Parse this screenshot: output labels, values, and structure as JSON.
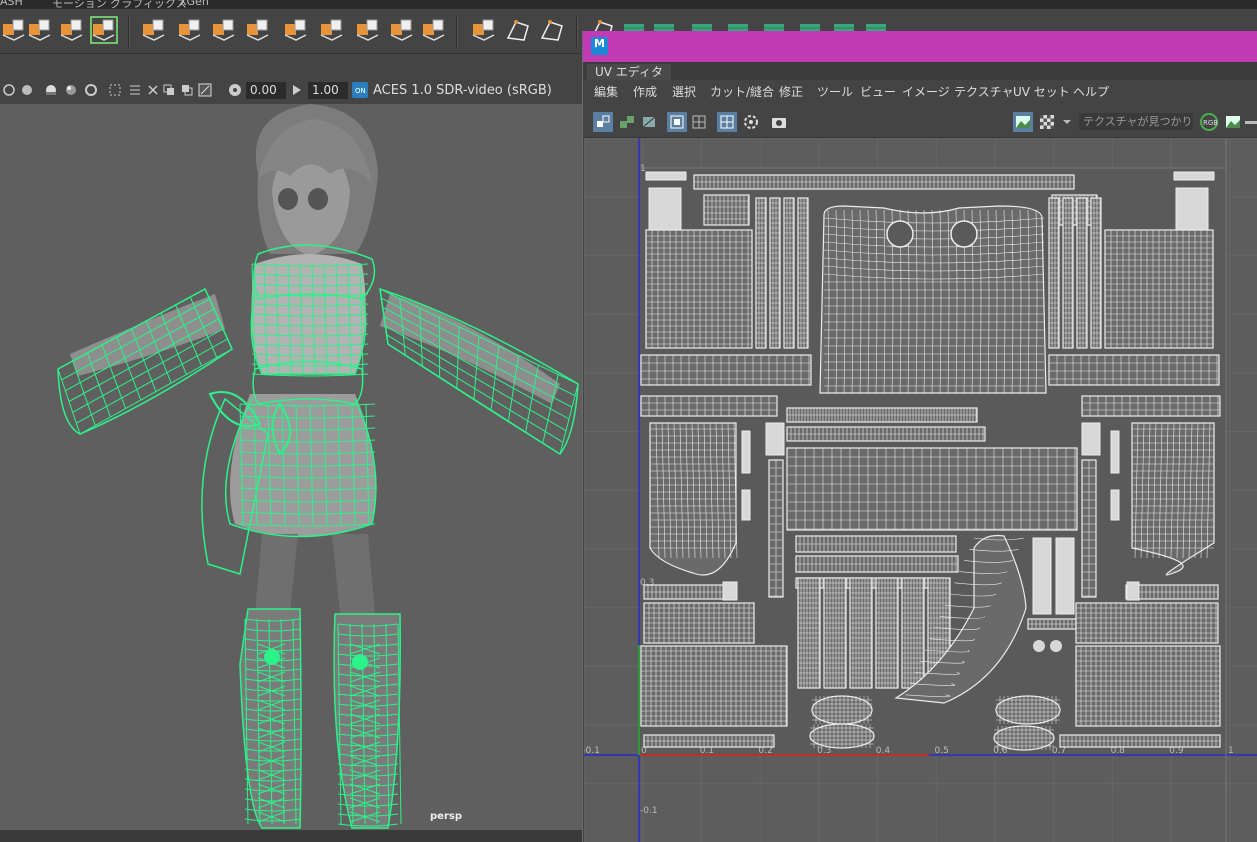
{
  "main_window": {
    "shelf_tabs": [
      "ASH",
      "モーション グラフィックス",
      "XGen"
    ],
    "shelf_icons": [
      "poly-cube-icon",
      "poly-plane-icon",
      "rotate-uv-icon",
      "rotate-uv-selected-icon",
      "extrude-icon",
      "bevel-icon",
      "bridge-icon",
      "merge-icon",
      "target-weld-icon",
      "multi-cut-icon",
      "insert-edgeloop-icon",
      "combine-icon",
      "separate-icon",
      "smooth-icon",
      "mirror-icon",
      "create-curve-icon",
      "select-tool-icon",
      "paint-select-icon",
      "uv-shell-icon",
      "uv-unfold-icon",
      "uv-layout-icon",
      "uv-cut-icon",
      "uv-sew-icon",
      "uv-editor-icon",
      "uv-grid-icon"
    ],
    "viewport_toolbar": {
      "exposure_value": "0.00",
      "gamma_value": "1.00",
      "color_space": "ACES 1.0 SDR-video (sRGB)"
    },
    "viewport": {
      "camera_label": "persp"
    }
  },
  "uv_editor": {
    "tab_label": "UV エディタ",
    "menu": [
      "編集",
      "作成",
      "選択",
      "カット/縫合",
      "修正",
      "ツール",
      "ビュー",
      "イメージ",
      "テクスチャ",
      "UV セット",
      "ヘルプ"
    ],
    "texture_field": "テクスチャが見つかり…",
    "axis_labels": {
      "u": [
        "-0.1",
        "0",
        "0.1",
        "0.2",
        "0.3",
        "0.4",
        "0.5",
        "0.6",
        "0.7",
        "0.8",
        "0.9",
        "1"
      ],
      "v": [
        "1",
        "0.3",
        "-0.1"
      ]
    },
    "colors": {
      "titlebar": "#c23ab4",
      "u_axis": "#c0302a",
      "v_axis": "#2a2ad0",
      "uv_lines": "#ececec",
      "selection": "#2cf28a"
    }
  }
}
